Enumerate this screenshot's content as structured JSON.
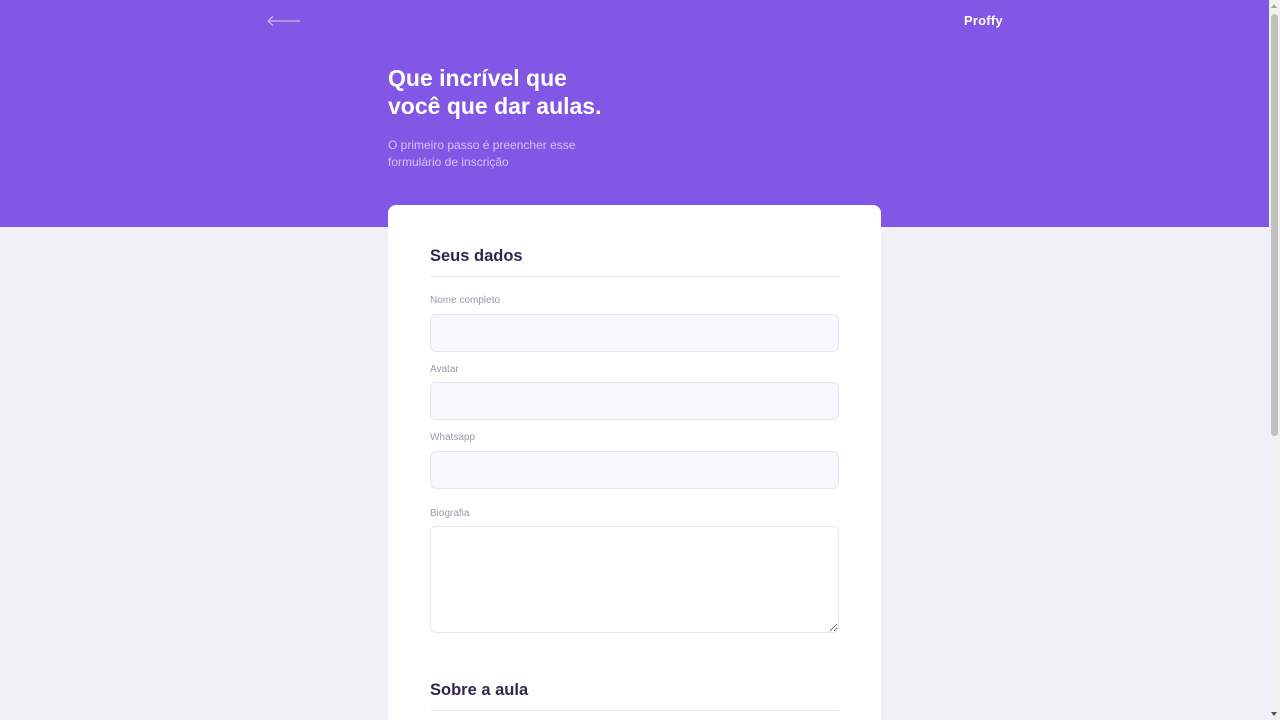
{
  "header": {
    "logo": "Proffy",
    "title_line1": "Que incrível que",
    "title_line2": "você que dar aulas.",
    "description_line1": "O primeiro passo é preencher esse",
    "description_line2": "formulário de inscrição"
  },
  "form": {
    "section_personal": "Seus dados",
    "name_label": "Nome completo",
    "name_value": "",
    "avatar_label": "Avatar",
    "avatar_value": "",
    "whatsapp_label": "Whatsapp",
    "whatsapp_value": "",
    "bio_label": "Biografia",
    "bio_value": "",
    "section_class": "Sobre a aula"
  },
  "icons": {
    "back": "arrow-left-icon"
  },
  "colors": {
    "primary": "#8257E5",
    "background": "#F0F0F7",
    "title_text": "#32264D",
    "label_text": "#9C98A6",
    "hero_desc": "#D4C2FF"
  }
}
